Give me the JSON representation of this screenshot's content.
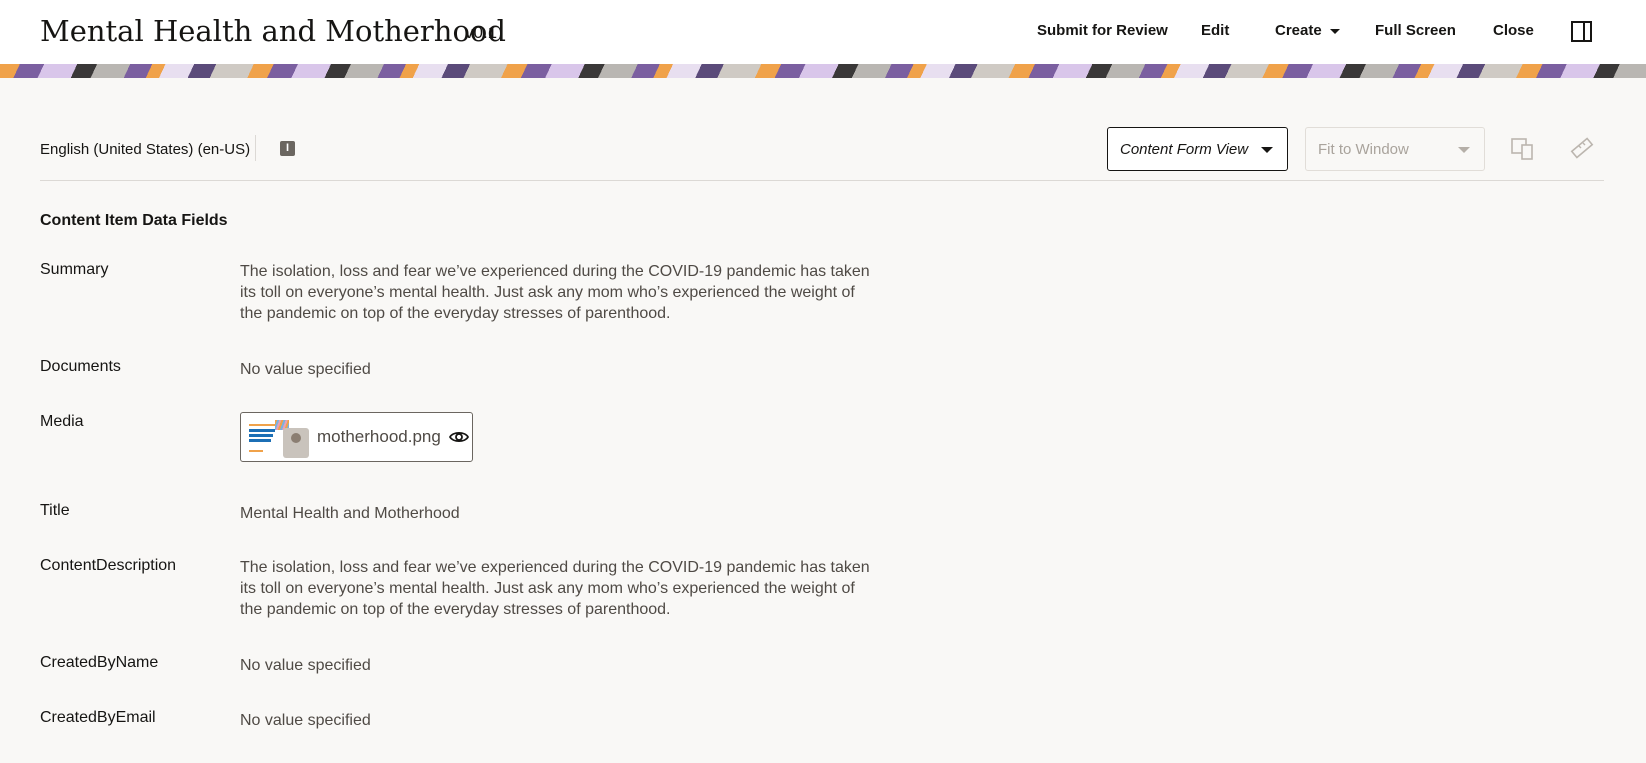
{
  "header": {
    "title": "Mental Health and Motherhood",
    "version": "v0.1",
    "actions": {
      "submit": "Submit for Review",
      "edit": "Edit",
      "create": "Create",
      "fullscreen": "Full Screen",
      "close": "Close"
    },
    "icons": {
      "panel": "side-panel-icon",
      "create_caret": "chevron-down-icon"
    }
  },
  "toolbar": {
    "language": "English (United States) (en-US)",
    "info_icon_glyph": "I",
    "view_select": "Content Form View",
    "zoom_select": "Fit to Window",
    "icons": [
      "device-preview-icon",
      "ruler-icon"
    ]
  },
  "content": {
    "section_title": "Content Item Data Fields",
    "fields": [
      {
        "label": "Summary",
        "value": "The isolation, loss and fear we’ve experienced during the COVID-19 pandemic has taken its toll on everyone’s mental health. Just ask any mom who’s experienced the weight of the pandemic on top of the everyday stresses of parenthood."
      },
      {
        "label": "Documents",
        "value": "No value specified"
      },
      {
        "label": "Media",
        "media": {
          "filename": "motherhood.png",
          "icon": "eye-icon"
        }
      },
      {
        "label": "Title",
        "value": "Mental Health and Motherhood"
      },
      {
        "label": "ContentDescription",
        "value": "The isolation, loss and fear we’ve experienced during the COVID-19 pandemic has taken its toll on everyone’s mental health. Just ask any mom who’s experienced the weight of the pandemic on top of the everyday stresses of parenthood."
      },
      {
        "label": "CreatedByName",
        "value": "No value specified"
      },
      {
        "label": "CreatedByEmail",
        "value": "No value specified"
      }
    ]
  },
  "colors": {
    "background": "#f9f8f6",
    "header": "#ffffff",
    "text": "#161513",
    "muted_text": "#4f4a45",
    "banner": [
      "#f0a24a",
      "#7b5fa0",
      "#d9c6ea",
      "#3a3838"
    ]
  }
}
